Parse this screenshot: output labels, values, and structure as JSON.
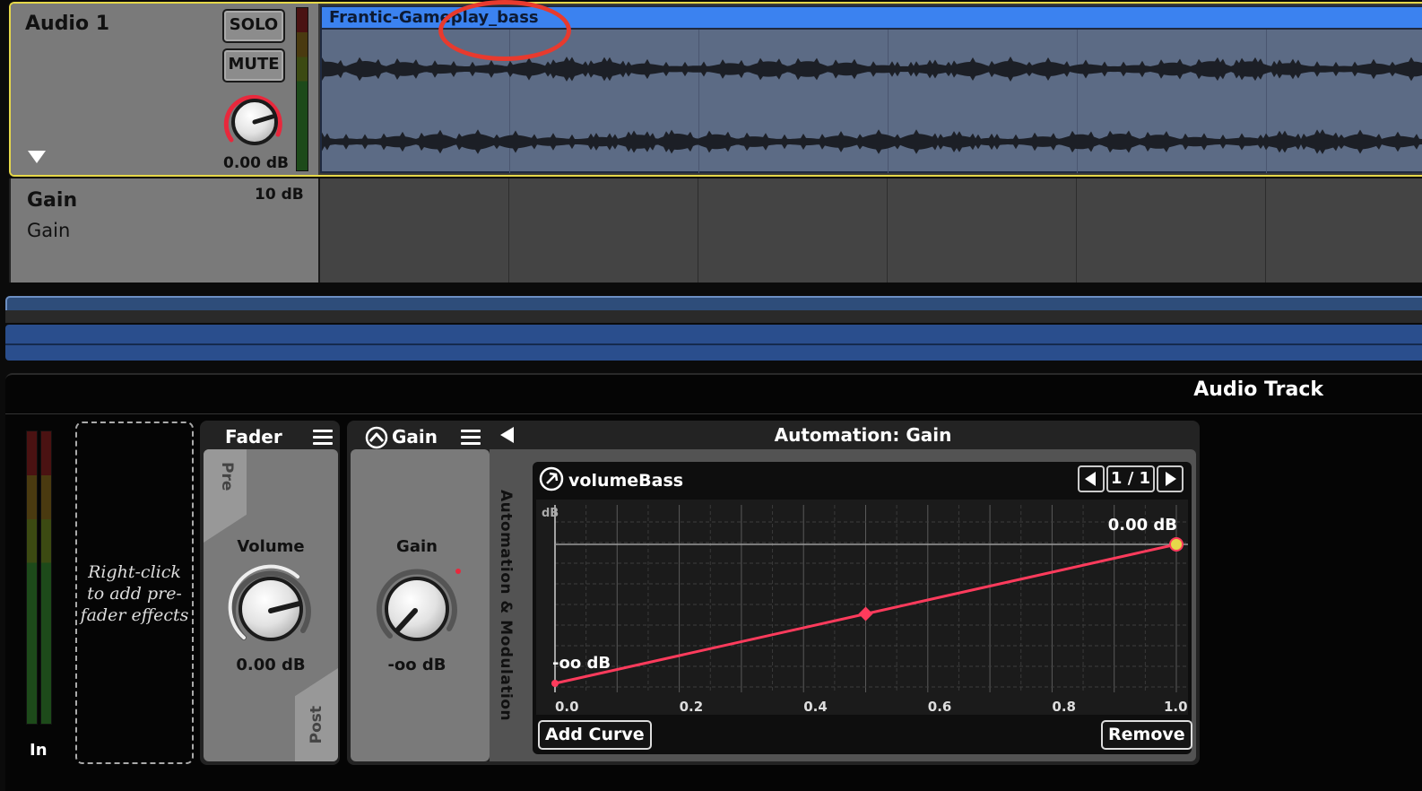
{
  "track": {
    "name": "Audio 1",
    "solo_label": "SOLO",
    "mute_label": "MUTE",
    "volume_readout": "0.00 dB",
    "clip_name": "Frantic-Gameplay_bass",
    "expand_icon": "triangle-down-icon"
  },
  "gain_lane": {
    "title": "Gain",
    "subtitle": "Gain",
    "max_label": "10 dB"
  },
  "bottom_panel": {
    "title": "Audio Track",
    "input_label": "In",
    "prefader_hint": "Right-click to add pre-fader effects"
  },
  "fader_plugin": {
    "title": "Fader",
    "pre_label": "Pre",
    "post_label": "Post",
    "volume_label": "Volume",
    "volume_value": "0.00 dB"
  },
  "gain_plugin": {
    "title": "Gain",
    "gain_label": "Gain",
    "gain_value": "-oo dB",
    "side_strip_label": "Automation & Modulation",
    "automation_title": "Automation: Gain"
  },
  "automation": {
    "curve_name": "volumeBass",
    "page_indicator": "1 / 1",
    "y_unit": "dB",
    "top_value_label": "0.00 dB",
    "bottom_value_label": "-oo dB",
    "x_ticks": [
      "0.0",
      "0.2",
      "0.4",
      "0.6",
      "0.8",
      "1.0"
    ],
    "add_curve_label": "Add Curve",
    "remove_label": "Remove",
    "curve_color": "#ff3b5c",
    "points": [
      {
        "x": 0.0,
        "y": 0.0
      },
      {
        "x": 0.5,
        "y": 0.5
      },
      {
        "x": 1.0,
        "y": 1.0
      }
    ]
  },
  "colors": {
    "clip_header": "#3b82f0",
    "selection_outline": "#e6d84a",
    "annotation_circle": "#e83a2e",
    "knob_ring": "#e8283c"
  }
}
